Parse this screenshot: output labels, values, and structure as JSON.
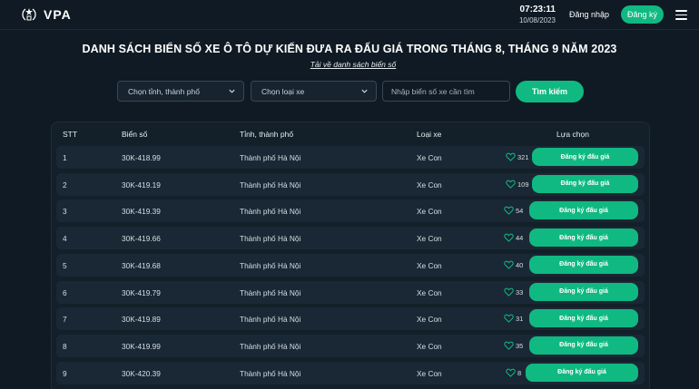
{
  "header": {
    "logo_text": "VPA",
    "time": "07:23:11",
    "date": "10/08/2023",
    "login_label": "Đăng nhập",
    "register_label": "Đăng ký",
    "accent_color": "#10b981"
  },
  "page": {
    "title": "DANH SÁCH BIỂN SỐ XE Ô TÔ DỰ KIẾN ĐƯA RA ĐẤU GIÁ TRONG THÁNG 8, THÁNG 9 NĂM 2023",
    "download_link": "Tải về danh sách biển số"
  },
  "filters": {
    "province_placeholder": "Chọn tỉnh, thành phố",
    "type_placeholder": "Chọn loại xe",
    "plate_placeholder": "Nhập biển số xe cần tìm",
    "search_label": "Tìm kiếm"
  },
  "table": {
    "headers": {
      "stt": "STT",
      "plate": "Biển số",
      "province": "Tỉnh, thành phố",
      "type": "Loại xe",
      "choice": "Lựa chọn"
    },
    "bid_label": "Đăng ký đấu giá",
    "rows": [
      {
        "stt": "1",
        "plate": "30K-418.99",
        "province": "Thành phố Hà Nội",
        "type": "Xe Con",
        "likes": "321"
      },
      {
        "stt": "2",
        "plate": "30K-419.19",
        "province": "Thành phố Hà Nội",
        "type": "Xe Con",
        "likes": "109"
      },
      {
        "stt": "3",
        "plate": "30K-419.39",
        "province": "Thành phố Hà Nội",
        "type": "Xe Con",
        "likes": "54"
      },
      {
        "stt": "4",
        "plate": "30K-419.66",
        "province": "Thành phố Hà Nội",
        "type": "Xe Con",
        "likes": "44"
      },
      {
        "stt": "5",
        "plate": "30K-419.68",
        "province": "Thành phố Hà Nội",
        "type": "Xe Con",
        "likes": "40"
      },
      {
        "stt": "6",
        "plate": "30K-419.79",
        "province": "Thành phố Hà Nội",
        "type": "Xe Con",
        "likes": "33"
      },
      {
        "stt": "7",
        "plate": "30K-419.89",
        "province": "Thành phố Hà Nội",
        "type": "Xe Con",
        "likes": "31"
      },
      {
        "stt": "8",
        "plate": "30K-419.99",
        "province": "Thành phố Hà Nội",
        "type": "Xe Con",
        "likes": "35"
      },
      {
        "stt": "9",
        "plate": "30K-420.39",
        "province": "Thành phố Hà Nội",
        "type": "Xe Con",
        "likes": "8"
      }
    ]
  }
}
